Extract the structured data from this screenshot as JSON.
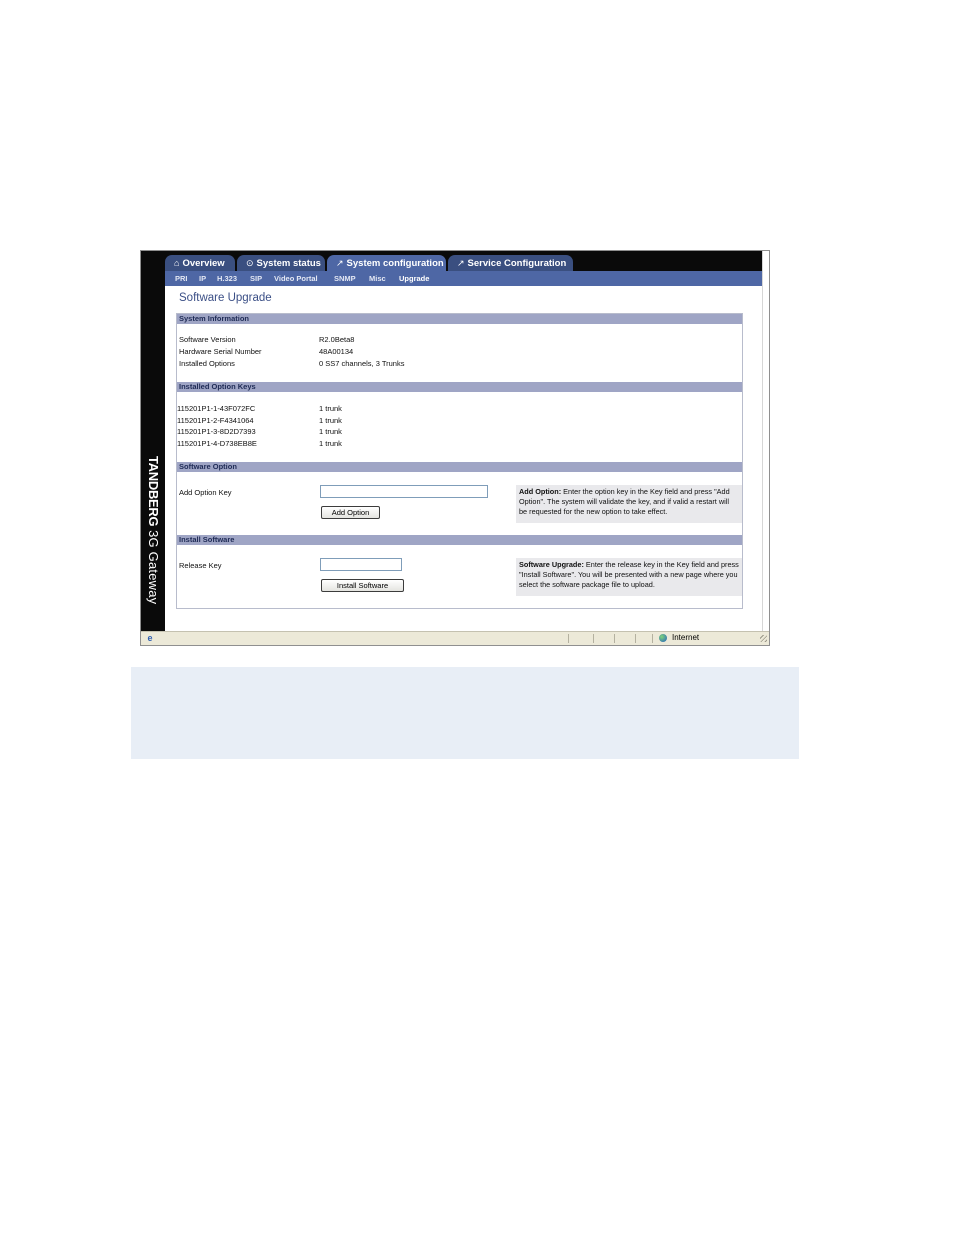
{
  "tabs": [
    {
      "icon": "⌂",
      "label": "Overview"
    },
    {
      "icon": "⊙",
      "label": "System status"
    },
    {
      "icon": "↗",
      "label": "System configuration"
    },
    {
      "icon": "↗",
      "label": "Service Configuration"
    }
  ],
  "active_tab": "System configuration",
  "subnav": [
    "PRI",
    "IP",
    "H.323",
    "SIP",
    "Video Portal",
    "SNMP",
    "Misc",
    "Upgrade"
  ],
  "brand": {
    "name": "TANDBERG",
    "product": "3G Gateway"
  },
  "page": {
    "title": "Software Upgrade"
  },
  "system_information": {
    "heading": "System Information",
    "rows": [
      {
        "label": "Software Version",
        "value": "R2.0Beta8"
      },
      {
        "label": "Hardware Serial Number",
        "value": "48A00134"
      },
      {
        "label": "Installed Options",
        "value": "0 SS7 channels, 3 Trunks"
      }
    ]
  },
  "option_keys": {
    "heading": "Installed Option Keys",
    "rows": [
      {
        "key": "115201P1-1-43F072FC",
        "value": "1 trunk"
      },
      {
        "key": "115201P1-2-F4341064",
        "value": "1 trunk"
      },
      {
        "key": "115201P1-3-8D2D7393",
        "value": "1 trunk"
      },
      {
        "key": "115201P1-4-D738EB8E",
        "value": "1 trunk"
      }
    ]
  },
  "software_option": {
    "heading": "Software Option",
    "field_label": "Add Option Key",
    "field_value": "",
    "button": "Add Option",
    "help_title": "Add Option:",
    "help_text": " Enter the option key in the Key field and press \"Add Option\". The system will validate the key, and if valid a restart will be requested for the new option to take effect."
  },
  "install_software": {
    "heading": "Install Software",
    "field_label": "Release Key",
    "field_value": "",
    "button": "Install Software",
    "help_title": "Software Upgrade:",
    "help_text": " Enter the release key in the Key field and press \"Install Software\". You will be presented with a new page where you select the software package file to upload."
  },
  "statusbar": {
    "zone": "Internet"
  }
}
